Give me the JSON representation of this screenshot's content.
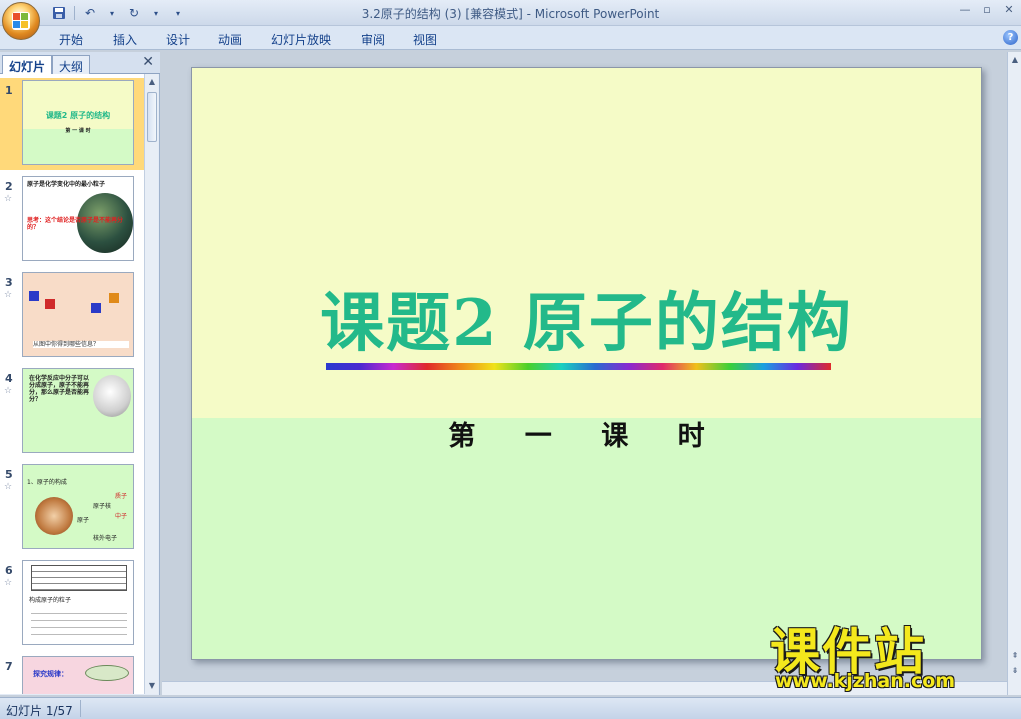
{
  "window": {
    "title": "3.2原子的结构 (3) [兼容模式] - Microsoft PowerPoint"
  },
  "ribbon": {
    "tabs": [
      "开始",
      "插入",
      "设计",
      "动画",
      "幻灯片放映",
      "审阅",
      "视图"
    ]
  },
  "left_pane": {
    "tab_slides": "幻灯片",
    "tab_outline": "大纲",
    "close_glyph": "✕",
    "thumbnails": [
      {
        "number": "1",
        "title": "课题2  原子的结构",
        "subtitle": "第 一 课 时"
      },
      {
        "number": "2",
        "text": "原子是化学变化中的最小粒子",
        "question": "思考：这个结论是否原子是不能再分的？"
      },
      {
        "number": "3",
        "text": "从图中你得到哪些信息？"
      },
      {
        "number": "4",
        "text": "在化学反应中分子可以分成原子，原子不能再分，那么原子是否能再分？"
      },
      {
        "number": "5",
        "text": "1、原子的构成",
        "labels": [
          "原子",
          "原子核",
          "质子",
          "中子",
          "核外电子"
        ]
      },
      {
        "number": "6",
        "text": "构成原子的粒子"
      },
      {
        "number": "7",
        "text": "探究规律："
      }
    ]
  },
  "slide": {
    "title": "课题2  原子的结构",
    "subtitle": "第 一 课 时"
  },
  "watermark": {
    "brand": "课件站",
    "url": "www.kjzhan.com"
  },
  "status": {
    "slide_counter": "幻灯片 1/57"
  },
  "colors": {
    "slide_bg_top": "#f5fbc7",
    "slide_bg_bottom": "#d4fac6",
    "title_color": "#23b98a",
    "selected_thumb": "#ffd97a",
    "watermark_color": "#f4e81c"
  }
}
